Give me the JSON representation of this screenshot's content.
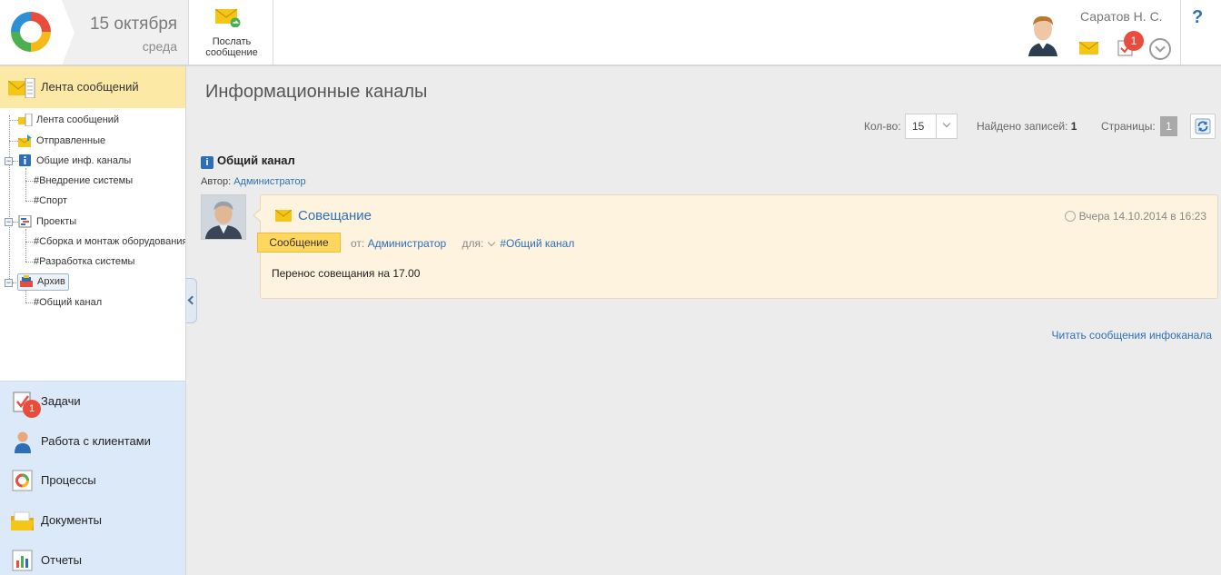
{
  "header": {
    "date": "15 октября",
    "weekday": "среда",
    "send_button_line1": "Послать",
    "send_button_line2": "сообщение",
    "user_name": "Саратов Н. С.",
    "tasks_badge": "1",
    "help": "?"
  },
  "sidebar": {
    "section_title": "Лента сообщений",
    "tree": {
      "feed": "Лента сообщений",
      "sent": "Отправленные",
      "common_channels": "Общие инф. каналы",
      "implementation": "#Внедрение системы",
      "sport": "#Спорт",
      "projects": "Проекты",
      "assembly": "#Сборка и монтаж оборудования",
      "development": "#Разработка системы",
      "archive": "Архив",
      "common_channel": "#Общий канал"
    },
    "modules": [
      {
        "label": "Задачи",
        "badge": "1"
      },
      {
        "label": "Работа с клиентами"
      },
      {
        "label": "Процессы"
      },
      {
        "label": "Документы"
      },
      {
        "label": "Отчеты"
      }
    ]
  },
  "main": {
    "title": "Информационные каналы",
    "pager": {
      "qty_label": "Кол-во:",
      "qty_value": "15",
      "found_label": "Найдено записей:",
      "found_value": "1",
      "pages_label": "Страницы:",
      "page_value": "1"
    },
    "channel": {
      "title": "Общий канал",
      "author_label": "Автор:",
      "author": "Администратор"
    },
    "message": {
      "subject": "Совещание",
      "time": "Вчера 14.10.2014 в 16:23",
      "type": "Сообщение",
      "from_label": "от:",
      "from": "Администратор",
      "to_label": "для:",
      "to": "#Общий канал",
      "body": "Перенос совещания на 17.00"
    },
    "read_link": "Читать сообщения инфоканала"
  },
  "colors": {
    "accent_blue": "#2f6fb6",
    "badge_red": "#e84c3d",
    "sidebar_head": "#fde9a6",
    "modules_bg": "#dce9f8",
    "message_bg": "#fdf3df",
    "type_tag": "#ffd65e"
  },
  "icons": [
    "logo-icon",
    "envelope-icon",
    "tasks-icon",
    "chevron-down-icon",
    "help-icon",
    "refresh-icon",
    "info-icon",
    "clock-icon",
    "archive-icon",
    "projects-icon",
    "processes-icon",
    "documents-icon",
    "reports-icon",
    "clients-icon"
  ]
}
